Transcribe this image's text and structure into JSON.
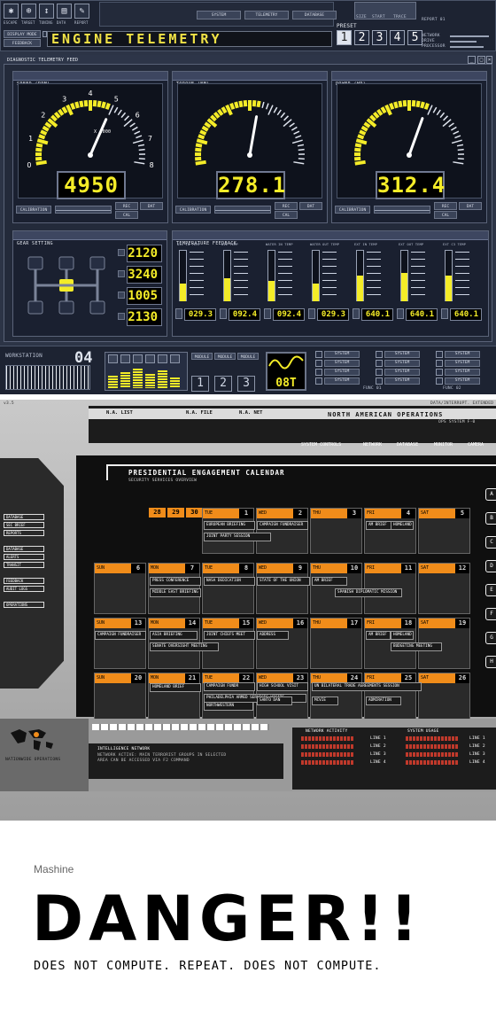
{
  "panel1": {
    "top_icons": [
      "ESCAPE",
      "TARGET",
      "TUNING",
      "DATA",
      "REPORT"
    ],
    "top_tabs": [
      "SYSTEM",
      "TELEMETRY",
      "DATABASE"
    ],
    "top_right_labels": [
      "SIZE",
      "START",
      "TRACE"
    ],
    "top_right_field": "REPORT 01",
    "side_buttons": [
      "DISPLAY MODE",
      "FEEDBACK"
    ],
    "title": "ENGINE TELEMETRY",
    "preset_label": "PRESET",
    "presets": [
      "1",
      "2",
      "3",
      "4",
      "5"
    ],
    "right_meters": [
      "NETWORK",
      "DRIVE",
      "PROCESSOR"
    ],
    "feed_title": "DIAGNOSTIC TELEMETRY FEED",
    "window_controls": [
      "_",
      "□",
      "×"
    ],
    "gauges": [
      {
        "title": "SPEED (RPM)",
        "value": "4950",
        "ticks": [
          "0",
          "1",
          "2",
          "3",
          "4",
          "5",
          "6",
          "7",
          "8"
        ],
        "unit": "X 1000",
        "calibration": "CALIBRATION",
        "buttons": [
          "REC",
          "DAT",
          "CAL"
        ],
        "level": 0.62
      },
      {
        "title": "TORQUE (NM)",
        "value": "278.1",
        "ticks": [],
        "unit": "",
        "calibration": "CALIBRATION",
        "buttons": [
          "REC",
          "DAT",
          "CAL"
        ],
        "level": 0.55
      },
      {
        "title": "POWER (HP)",
        "value": "312.4",
        "ticks": [],
        "unit": "",
        "calibration": "CALIBRATION",
        "buttons": [
          "REC",
          "DAT",
          "CAL"
        ],
        "level": 0.6
      }
    ],
    "gear_title": "GEAR SETTING",
    "gear_values": [
      "2120",
      "3240",
      "1005",
      "2130"
    ],
    "temp_title": "TEMPERATURE FEEDBACK",
    "thermometers": [
      {
        "label": "OIL IN TEMP",
        "value": "029.3",
        "level": 0.35
      },
      {
        "label": "OIL TEMP",
        "value": "092.4",
        "level": 0.45
      },
      {
        "label": "WATER IN TEMP",
        "value": "092.4",
        "level": 0.4
      },
      {
        "label": "WATER OUT TEMP",
        "value": "029.3",
        "level": 0.35
      },
      {
        "label": "EXT IN TEMP",
        "value": "640.1",
        "level": 0.5
      },
      {
        "label": "EXT OUT TEMP",
        "value": "640.1",
        "level": 0.55
      },
      {
        "label": "EXT C3 TEMP",
        "value": "640.1",
        "level": 0.5
      }
    ],
    "workstation_label": "WORKSTATION",
    "workstation_number": "04",
    "modules": [
      "MODULE",
      "MODULE",
      "MODULE"
    ],
    "module_digits": [
      "1",
      "2",
      "3"
    ],
    "scope_value": "08T",
    "system_labels": [
      "SYSTEM",
      "SYSTEM",
      "SYSTEM",
      "SYSTEM",
      "SYSTEM",
      "SYSTEM",
      "SYSTEM",
      "SYSTEM",
      "SYSTEM",
      "SYSTEM",
      "SYSTEM",
      "SYSTEM"
    ],
    "func_labels": [
      "FUNC 01",
      "FUNC 02"
    ]
  },
  "panel2": {
    "version": "v3.5",
    "top_status": "DATA/INTERRUPT. EXTENDED",
    "tabs": [
      "N.A. LIST",
      "N.A. FILE",
      "N.A. NET"
    ],
    "ops_title": "NORTH AMERICAN OPERATIONS",
    "ops_sub": "OPS SYSTEM F-0",
    "nav": [
      "SYSTEM CONTROLS",
      "NETWORK",
      "DATABASE",
      "MONITOR",
      "CAMERA"
    ],
    "cal_title": "PRESIDENTIAL ENGAGEMENT CALENDAR",
    "cal_sub": "SECURITY SERVICES OVERVIEW",
    "sidebar": [
      "DATABASE",
      "SEC BRIEF",
      "REPORTS",
      "",
      "DATABASE",
      "ALERTS",
      "TRANSIT",
      "",
      "FEEDBACK",
      "AUDIT LOGS",
      "",
      "OPERATIONS"
    ],
    "side_letters": [
      "A",
      "B",
      "C",
      "D",
      "E",
      "F",
      "G",
      "H"
    ],
    "weeks": [
      [
        {
          "day": "",
          "num": "28"
        },
        {
          "day": "",
          "num": "29"
        },
        {
          "day": "",
          "num": "30"
        },
        {
          "day": "TUE",
          "num": "1"
        },
        {
          "day": "WED",
          "num": "2"
        },
        {
          "day": "THU",
          "num": "3"
        },
        {
          "day": "FRI",
          "num": "4"
        },
        {
          "day": "SAT",
          "num": "5"
        }
      ],
      [
        {
          "day": "SUN",
          "num": "6"
        },
        {
          "day": "MON",
          "num": "7"
        },
        {
          "day": "TUE",
          "num": "8"
        },
        {
          "day": "WED",
          "num": "9"
        },
        {
          "day": "THU",
          "num": "10"
        },
        {
          "day": "FRI",
          "num": "11"
        },
        {
          "day": "SAT",
          "num": "12"
        }
      ],
      [
        {
          "day": "SUN",
          "num": "13"
        },
        {
          "day": "MON",
          "num": "14"
        },
        {
          "day": "TUE",
          "num": "15"
        },
        {
          "day": "WED",
          "num": "16"
        },
        {
          "day": "THU",
          "num": "17"
        },
        {
          "day": "FRI",
          "num": "18"
        },
        {
          "day": "SAT",
          "num": "19"
        }
      ],
      [
        {
          "day": "SUN",
          "num": "20"
        },
        {
          "day": "MON",
          "num": "21"
        },
        {
          "day": "TUE",
          "num": "22"
        },
        {
          "day": "WED",
          "num": "23"
        },
        {
          "day": "THU",
          "num": "24"
        },
        {
          "day": "FRI",
          "num": "25"
        },
        {
          "day": "SAT",
          "num": "26"
        }
      ],
      [
        {
          "day": "SUN",
          "num": "27"
        },
        {
          "day": "MON",
          "num": "28"
        },
        {
          "day": "TUE",
          "num": "29"
        },
        {
          "day": "WED",
          "num": "30"
        },
        {
          "day": "THU",
          "num": "31"
        }
      ]
    ],
    "events": [
      "EUROPEAN BRIEFING",
      "JOINT PARTY SESSION",
      "CAMPAIGN FUNDRAISER",
      "AM BRIEF",
      "HOMELAND",
      "PRESS CONFERENCE",
      "MIDDLE EAST BRIEFING",
      "NASA DEDICATION",
      "STATE OF THE UNION",
      "AM BRIEF",
      "SPANISH DIPLOMATIC MISSION",
      "CAMPAIGN FUNDRAISER",
      "ASIA BRIEFING",
      "SENATE OVERSIGHT MEETING",
      "JOINT CHIEFS MEET",
      "ADDRESS",
      "AM BRIEF",
      "HOMELAND",
      "BUDGETING MEETING",
      "HOMELAND BRIEF",
      "CAMPAIGN FUNDR",
      "PHILADELPHIA ARMED SERVICES VISITS",
      "NORTHWESTERN",
      "HIGH SCHOOL VISIT",
      "SANTO DAN",
      "UN BILATERAL TRADE AGREEMENTS SESSION",
      "MCVIE",
      "ADMIRATION",
      "GERMAN CHANCELLOR ENGAGEMENTS",
      "NATO ANNUAL MEMBERS BRIEFING"
    ],
    "page_buttons": [
      "1",
      "2",
      "3"
    ],
    "map_caption": "NATIONWIDE OPERATIONS",
    "intel_title": "INTELLIGENCE NETWORK",
    "intel_text": [
      "NETWORK ACTIVE: MAIN TERRORIST GROUPS IN SELECTED",
      "AREA CAN BE ACCESSED VIA F2 COMMAND"
    ],
    "net_title": "NETWORK ACTIVITY",
    "sys_title": "SYSTEM USAGE",
    "lines": [
      "LINE 1",
      "LINE 2",
      "LINE 3",
      "LINE 4"
    ]
  },
  "footer": {
    "label": "Mashine",
    "headline": "DANGER!!",
    "subline": "DOES NOT COMPUTE. REPEAT. DOES NOT COMPUTE."
  },
  "colors": {
    "accent": "#f4ec28",
    "orange": "#f08c1a",
    "panel": "#2c3446"
  }
}
